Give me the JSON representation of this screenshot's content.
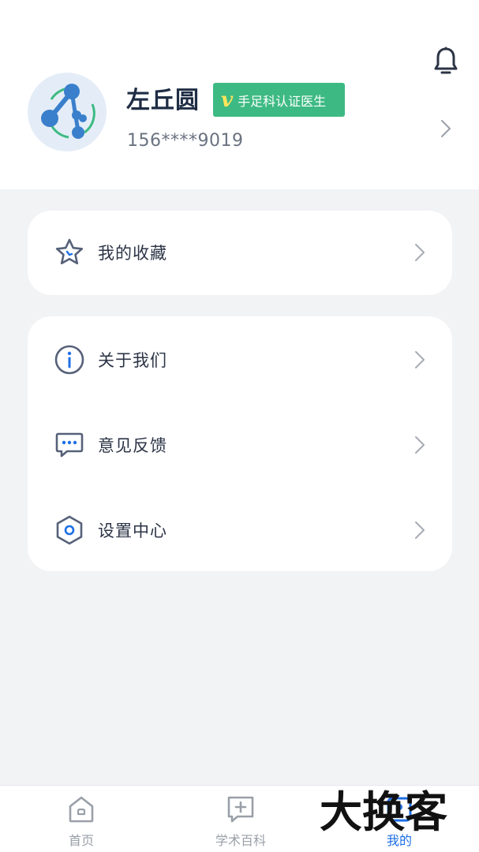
{
  "profile": {
    "name": "左丘圆",
    "badge_mark": "v",
    "badge_text": "手足科认证医生",
    "phone": "156****9019"
  },
  "menu": {
    "favorites": "我的收藏",
    "about": "关于我们",
    "feedback": "意见反馈",
    "settings": "设置中心"
  },
  "nav": {
    "home": "首页",
    "academic": "学术百科",
    "mine": "我的"
  },
  "watermark": "大换客",
  "colors": {
    "accent": "#1d6fe6",
    "badge": "#3dba83",
    "icon": "#566179"
  }
}
